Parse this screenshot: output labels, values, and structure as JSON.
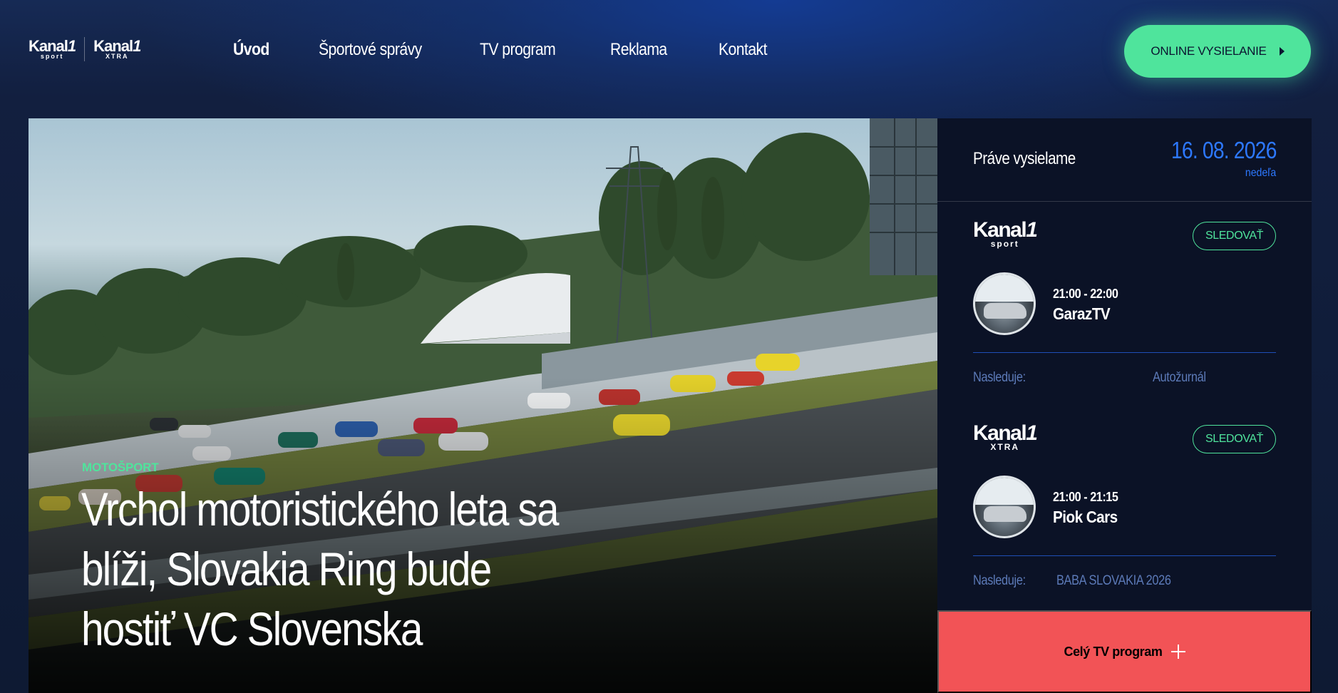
{
  "brand": {
    "logos": [
      {
        "name": "Kanal",
        "number": "1",
        "sub": "sport"
      },
      {
        "name": "Kanal",
        "number": "1",
        "sub": "XTRA"
      }
    ]
  },
  "nav": {
    "items": [
      {
        "label": "Úvod",
        "active": true
      },
      {
        "label": "Športové správy",
        "active": false
      },
      {
        "label": "TV program",
        "active": false
      },
      {
        "label": "Reklama",
        "active": false
      },
      {
        "label": "Kontakt",
        "active": false
      }
    ]
  },
  "header": {
    "online_button_label": "ONLINE VYSIELANIE",
    "online_button_icon": "play-triangle-icon"
  },
  "hero": {
    "category": "MOTOŠPORT",
    "title": "Vrchol motoristického leta sa blíži, Slovakia Ring bude hostiť VC Slovenska"
  },
  "schedule": {
    "heading": "Práve vysielame",
    "date": "16. 08. 2026",
    "day": "nedeľa",
    "channels": [
      {
        "logo_name": "Kanal",
        "logo_number": "1",
        "logo_sub": "sport",
        "watch_label": "SLEDOVAŤ",
        "time": "21:00 - 22:00",
        "show": "GarazTV",
        "next_label": "Nasleduje:",
        "next_show": "Autožurnál"
      },
      {
        "logo_name": "Kanal",
        "logo_number": "1",
        "logo_sub": "XTRA",
        "watch_label": "SLEDOVAŤ",
        "time": "21:00 - 21:15",
        "show": "Piok Cars",
        "next_label": "Nasleduje:",
        "next_show": "BABA SLOVAKIA 2026"
      }
    ],
    "full_program_label": "Celý TV program"
  },
  "colors": {
    "accent_green": "#4fe49c",
    "accent_blue": "#2d78ff",
    "accent_red": "#f25356",
    "panel_bg": "#0b1226"
  }
}
